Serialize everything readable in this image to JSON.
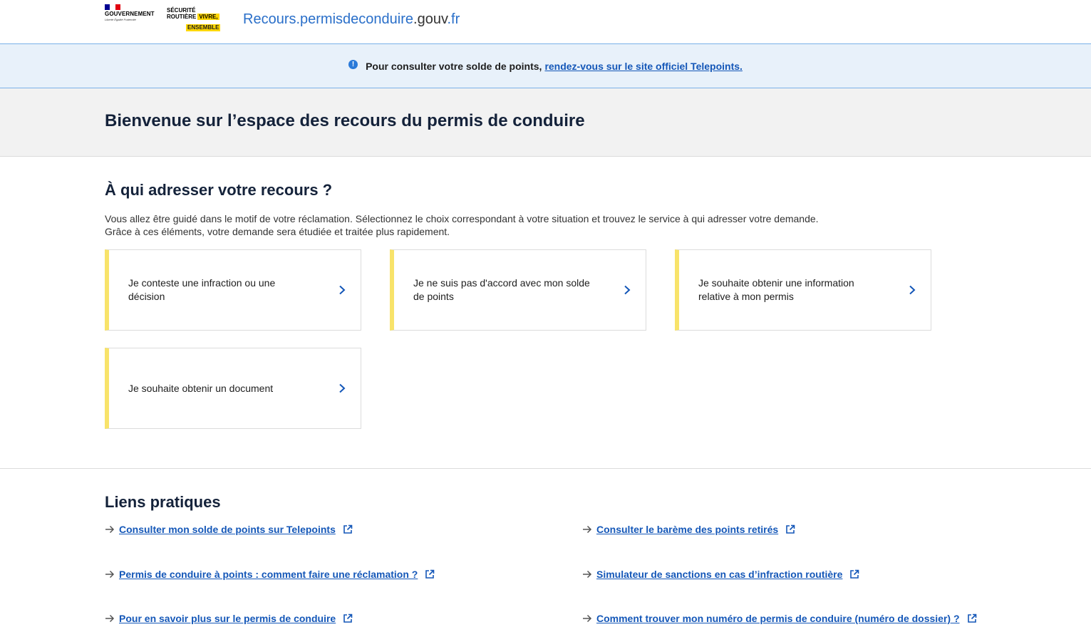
{
  "header": {
    "gov_name": "GOUVERNEMENT",
    "gov_motto": "Liberté Égalité Fraternité",
    "sr_line1": "SÉCURITÉ",
    "sr_line2": "ROUTIÈRE",
    "sr_vivre": "VIVRE,",
    "sr_ensemble": "ENSEMBLE",
    "site_title_main": "Recours.permisdeconduire",
    "site_title_suffix": ".gouv",
    "site_title_tld": ".fr"
  },
  "banner": {
    "text": "Pour consulter votre solde de points,",
    "link": "rendez-vous sur le site officiel Telepoints.",
    "icon": "info-icon"
  },
  "hero": {
    "title": "Bienvenue sur l’espace des recours du permis de conduire"
  },
  "main": {
    "heading": "À qui adresser votre recours ?",
    "intro_line1": "Vous allez être guidé dans le motif de votre réclamation. Sélectionnez le choix correspondant à votre situation et trouvez le service à qui adresser votre demande.",
    "intro_line2": "Grâce à ces éléments, votre demande sera étudiée et traitée plus rapidement.",
    "cards": [
      {
        "label": "Je conteste une infraction ou une décision"
      },
      {
        "label": "Je ne suis pas d'accord avec mon solde de points"
      },
      {
        "label": "Je souhaite obtenir une information relative à mon permis"
      },
      {
        "label": "Je souhaite obtenir un document"
      }
    ]
  },
  "links": {
    "heading": "Liens pratiques",
    "items": [
      {
        "label": "Consulter mon solde de points sur Telepoints"
      },
      {
        "label": "Consulter le barème des points retirés"
      },
      {
        "label": "Permis de conduire à points : comment faire une réclamation ?"
      },
      {
        "label": "Simulateur de sanctions en cas d’infraction routière"
      },
      {
        "label": "Pour en savoir plus sur le permis de conduire"
      },
      {
        "label": "Comment trouver mon numéro de permis de conduire (numéro de dossier) ?"
      }
    ]
  },
  "colors": {
    "accent": "#1457b8",
    "card_border_accent": "#f8e36a",
    "banner_bg": "#e8f1fa",
    "hero_bg": "#f2f2f2"
  }
}
